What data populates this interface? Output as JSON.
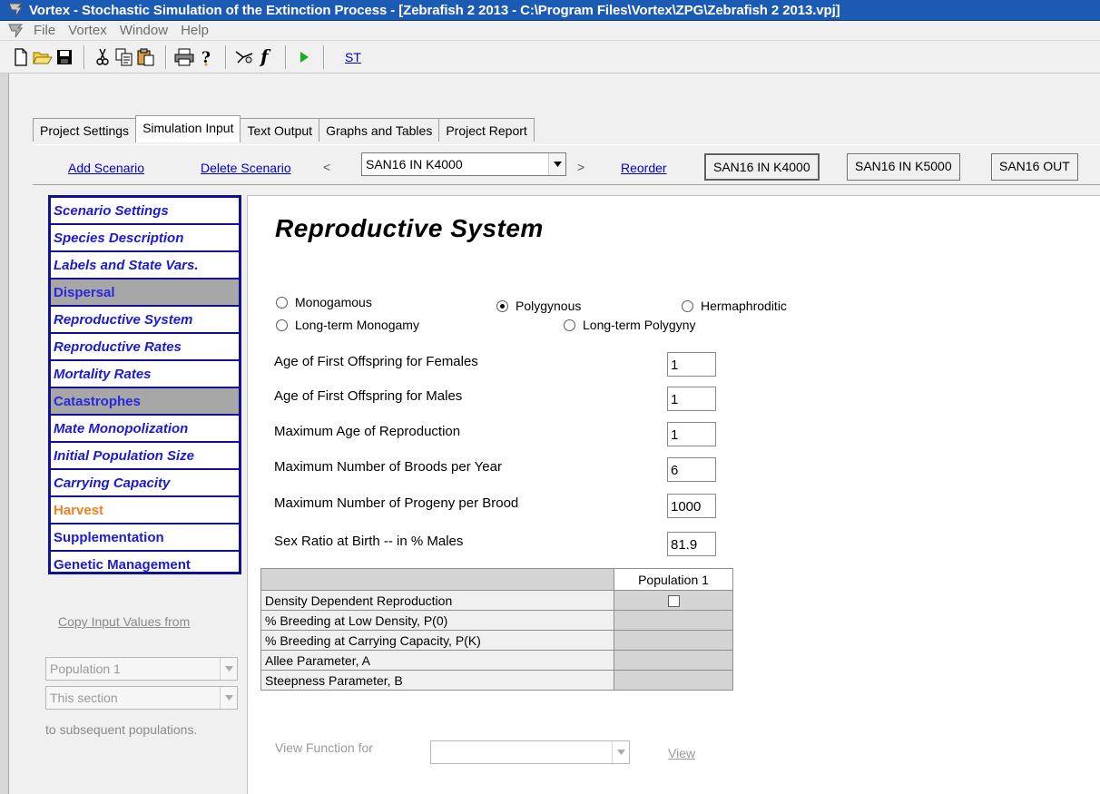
{
  "window": {
    "title": "Vortex - Stochastic Simulation of the Extinction Process - [Zebrafish 2 2013 - C:\\Program Files\\Vortex\\ZPG\\Zebrafish 2 2013.vpj]"
  },
  "menu": [
    "File",
    "Vortex",
    "Window",
    "Help"
  ],
  "toolbar": {
    "icons": [
      "new-icon",
      "open-icon",
      "save-icon",
      "cut-icon",
      "copy-icon",
      "paste-icon",
      "print-icon",
      "help-icon",
      "tools-icon",
      "function-icon",
      "run-icon"
    ],
    "st_label": "ST"
  },
  "tabs": [
    "Project Settings",
    "Simulation Input",
    "Text Output",
    "Graphs and Tables",
    "Project Report"
  ],
  "active_tab": "Simulation Input",
  "scenario_bar": {
    "add_label": "Add Scenario",
    "delete_label": "Delete Scenario",
    "prev_arrow": "<",
    "next_arrow": ">",
    "selected_scenario": "SAN16 IN K4000",
    "reorder_label": "Reorder",
    "scenario_buttons": [
      "SAN16 IN K4000",
      "SAN16 IN K5000",
      "SAN16 OUT"
    ]
  },
  "nav": [
    "Scenario Settings",
    "Species Description",
    "Labels and State Vars.",
    "Dispersal",
    "Reproductive System",
    "Reproductive Rates",
    "Mortality Rates",
    "Catastrophes",
    "Mate Monopolization",
    "Initial Population Size",
    "Carrying Capacity",
    "Harvest",
    "Supplementation",
    "Genetic Management"
  ],
  "copy": {
    "label": "Copy Input Values from",
    "population_value": "Population  1",
    "section_value": "This section",
    "subsequent_label": "to subsequent populations."
  },
  "section": {
    "heading": "Reproductive System",
    "radios": {
      "monogamous": "Monogamous",
      "polygynous": "Polygynous",
      "hermaphroditic": "Hermaphroditic",
      "long_term_monogamy": "Long-term Monogamy",
      "long_term_polygyny": "Long-term Polygyny"
    },
    "selected_mating_system": "Polygynous",
    "fields": {
      "age_first_female_label": "Age of First Offspring for Females",
      "age_first_female_value": "1",
      "age_first_male_label": "Age of First Offspring for Males",
      "age_first_male_value": "1",
      "max_age_label": "Maximum Age of Reproduction",
      "max_age_value": "1",
      "max_broods_label": "Maximum Number of Broods per Year",
      "max_broods_value": "6",
      "max_progeny_label": "Maximum Number of Progeny per Brood",
      "max_progeny_value": "1000",
      "sex_ratio_label": "Sex Ratio at Birth -- in % Males",
      "sex_ratio_value": "81.9"
    },
    "grid": {
      "column": "Population 1",
      "rows": [
        "Density Dependent Reproduction",
        "% Breeding at Low Density, P(0)",
        "% Breeding at Carrying Capacity, P(K)",
        "Allee Parameter, A",
        "Steepness Parameter, B"
      ],
      "density_dependent_checked": false
    },
    "view_function_label": "View Function for",
    "view_label": "View"
  }
}
